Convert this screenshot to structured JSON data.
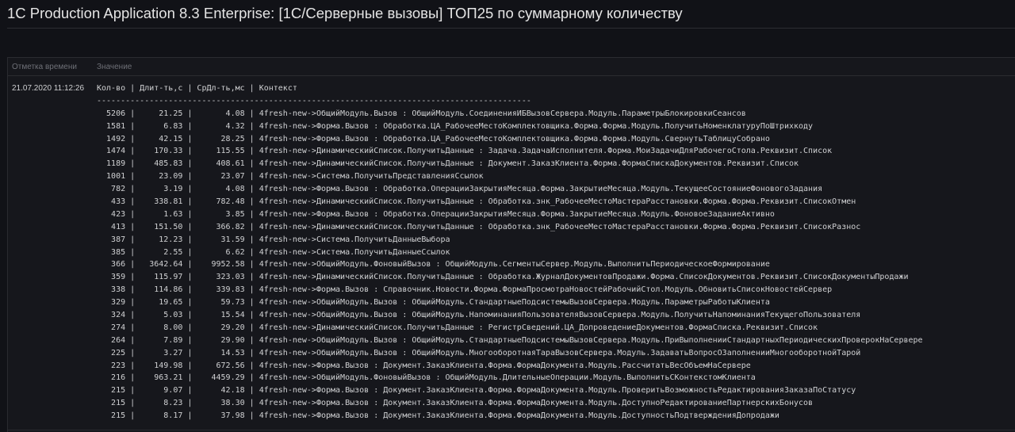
{
  "title": "1C Production Application 8.3 Enterprise: [1С/Серверные вызовы] ТОП25 по суммарному количеству",
  "table": {
    "col_time": "Отметка времени",
    "col_value": "Значение"
  },
  "timestamp": "21.07.2020 11:12:26",
  "lines": [
    "Кол-во | Длит-ть,с | СрДл-ть,мс | Контекст",
    "-------------------------------------------------------------------------------------------",
    "  5206 |     21.25 |       4.08 | 4fresh-new->ОбщийМодуль.Вызов : ОбщийМодуль.СоединенияИБВызовСервера.Модуль.ПараметрыБлокировкиСеансов",
    "  1581 |      6.83 |       4.32 | 4fresh-new->Форма.Вызов : Обработка.ЦА_РабочееМестоКомплектовщика.Форма.Форма.Модуль.ПолучитьНоменклатуруПоШтрихкоду",
    "  1492 |     42.15 |      28.25 | 4fresh-new->Форма.Вызов : Обработка.ЦА_РабочееМестоКомплектовщика.Форма.Форма.Модуль.СвернутьТаблицуСобрано",
    "  1474 |    170.33 |     115.55 | 4fresh-new->ДинамическийСписок.ПолучитьДанные : Задача.ЗадачаИсполнителя.Форма.МоиЗадачиДляРабочегоСтола.Реквизит.Список",
    "  1189 |    485.83 |     408.61 | 4fresh-new->ДинамическийСписок.ПолучитьДанные : Документ.ЗаказКлиента.Форма.ФормаСпискаДокументов.Реквизит.Список",
    "  1001 |     23.09 |      23.07 | 4fresh-new->Система.ПолучитьПредставленияСсылок",
    "   782 |      3.19 |       4.08 | 4fresh-new->Форма.Вызов : Обработка.ОперацииЗакрытияМесяца.Форма.ЗакрытиеМесяца.Модуль.ТекущееСостояниеФоновогоЗадания",
    "   433 |    338.81 |     782.48 | 4fresh-new->ДинамическийСписок.ПолучитьДанные : Обработка.знк_РабочееМестоМастераРасстановки.Форма.Форма.Реквизит.СписокОтмен",
    "   423 |      1.63 |       3.85 | 4fresh-new->Форма.Вызов : Обработка.ОперацииЗакрытияМесяца.Форма.ЗакрытиеМесяца.Модуль.ФоновоеЗаданиеАктивно",
    "   413 |    151.50 |     366.82 | 4fresh-new->ДинамическийСписок.ПолучитьДанные : Обработка.знк_РабочееМестоМастераРасстановки.Форма.Форма.Реквизит.СписокРазнос",
    "   387 |     12.23 |      31.59 | 4fresh-new->Система.ПолучитьДанныеВыбора",
    "   385 |      2.55 |       6.62 | 4fresh-new->Система.ПолучитьДанныеСсылок",
    "   366 |   3642.64 |    9952.58 | 4fresh-new->ОбщийМодуль.ФоновыйВызов : ОбщийМодуль.СегментыСервер.Модуль.ВыполнитьПериодическоеФормирование",
    "   359 |    115.97 |     323.03 | 4fresh-new->ДинамическийСписок.ПолучитьДанные : Обработка.ЖурналДокументовПродажи.Форма.СписокДокументов.Реквизит.СписокДокументыПродажи",
    "   338 |    114.86 |     339.83 | 4fresh-new->Форма.Вызов : Справочник.Новости.Форма.ФормаПросмотраНовостейРабочийСтол.Модуль.ОбновитьСписокНовостейСервер",
    "   329 |     19.65 |      59.73 | 4fresh-new->ОбщийМодуль.Вызов : ОбщийМодуль.СтандартныеПодсистемыВызовСервера.Модуль.ПараметрыРаботыКлиента",
    "   324 |      5.03 |      15.54 | 4fresh-new->ОбщийМодуль.Вызов : ОбщийМодуль.НапоминанияПользователяВызовСервера.Модуль.ПолучитьНапоминанияТекущегоПользователя",
    "   274 |      8.00 |      29.20 | 4fresh-new->ДинамическийСписок.ПолучитьДанные : РегистрСведений.ЦА_ДопроведениеДокументов.ФормаСписка.Реквизит.Список",
    "   264 |      7.89 |      29.90 | 4fresh-new->ОбщийМодуль.Вызов : ОбщийМодуль.СтандартныеПодсистемыВызовСервера.Модуль.ПриВыполненииСтандартныхПериодическихПроверокНаСервере",
    "   225 |      3.27 |      14.53 | 4fresh-new->ОбщийМодуль.Вызов : ОбщийМодуль.МногооборотнаяТараВызовСервера.Модуль.ЗадаватьВопросОЗаполненииМногооборотнойТарой",
    "   223 |    149.98 |     672.56 | 4fresh-new->Форма.Вызов : Документ.ЗаказКлиента.Форма.ФормаДокумента.Модуль.РассчитатьВесОбъемНаСервере",
    "   216 |    963.21 |    4459.29 | 4fresh-new->ОбщийМодуль.ФоновыйВызов : ОбщийМодуль.ДлительныеОперации.Модуль.ВыполнитьСКонтекстомКлиента",
    "   215 |      9.07 |      42.18 | 4fresh-new->Форма.Вызов : Документ.ЗаказКлиента.Форма.ФормаДокумента.Модуль.ПроверитьВозможностьРедактированияЗаказаПоСтатусу",
    "   215 |      8.23 |      38.30 | 4fresh-new->Форма.Вызов : Документ.ЗаказКлиента.Форма.ФормаДокумента.Модуль.ДоступноРедактированиеПартнерскихБонусов",
    "   215 |      8.17 |      37.98 | 4fresh-new->Форма.Вызов : Документ.ЗаказКлиента.Форма.ФормаДокумента.Модуль.ДоступностьПодтвержденияДопродажи"
  ]
}
